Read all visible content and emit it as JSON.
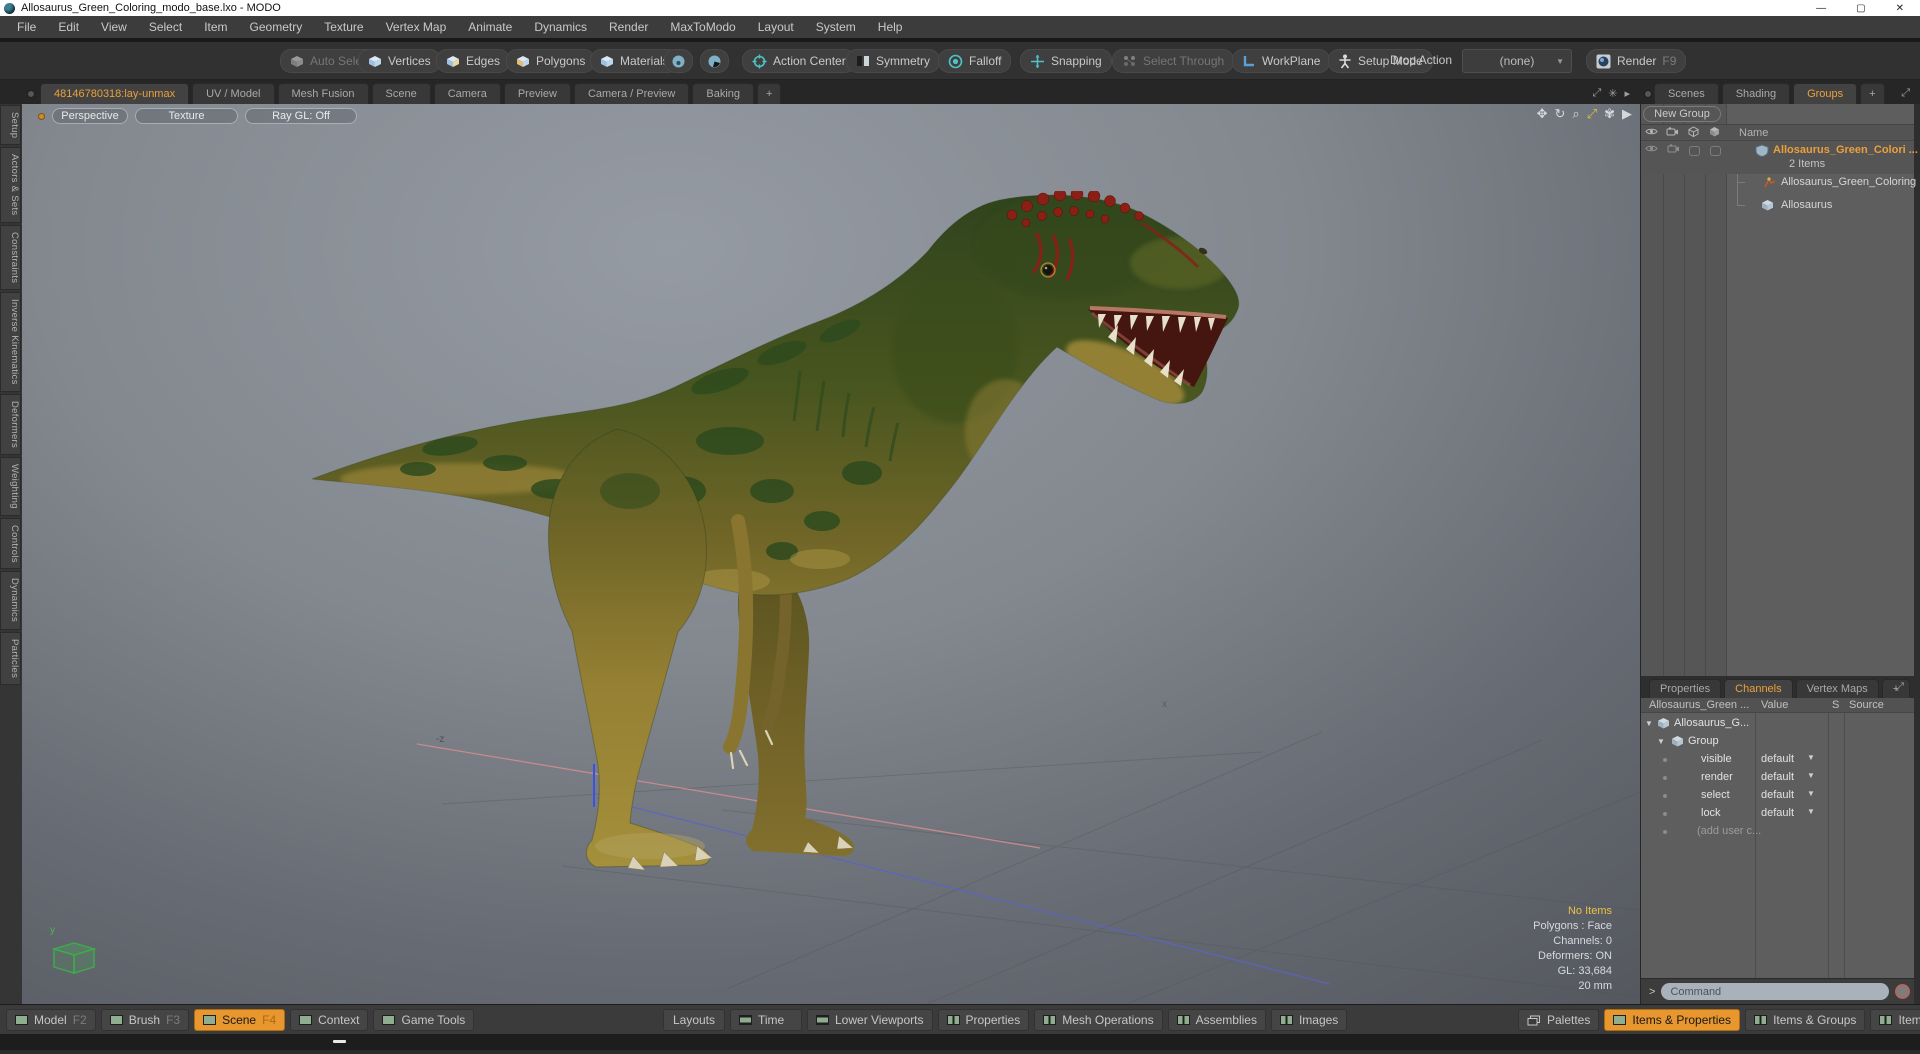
{
  "window": {
    "title": "Allosaurus_Green_Coloring_modo_base.lxo - MODO",
    "minimize": "—",
    "maximize": "▢",
    "close": "✕"
  },
  "menu": {
    "items": [
      "File",
      "Edit",
      "View",
      "Select",
      "Item",
      "Geometry",
      "Texture",
      "Vertex Map",
      "Animate",
      "Dynamics",
      "Render",
      "MaxToModo",
      "Layout",
      "System",
      "Help"
    ]
  },
  "toolbar": {
    "auto_select": "Auto Select",
    "vertices": "Vertices",
    "edges": "Edges",
    "polygons": "Polygons",
    "materials": "Materials",
    "action_center": "Action Center",
    "symmetry": "Symmetry",
    "falloff": "Falloff",
    "snapping": "Snapping",
    "select_through": "Select Through",
    "workplane": "WorkPlane",
    "setup_mode": "Setup Mode",
    "drop_action": "Drop Action",
    "drop_action_value": "(none)",
    "render": "Render",
    "render_shortcut": "F9"
  },
  "layout_tabs": {
    "active": "48146780318:lay-unmax",
    "items": [
      "UV / Model",
      "Mesh Fusion",
      "Scene",
      "Camera",
      "Preview",
      "Camera / Preview",
      "Baking"
    ],
    "add": "+"
  },
  "rail": {
    "items": [
      "Setup",
      "Actors & Sets",
      "Constraints",
      "Inverse Kinematics",
      "Deformers",
      "Weighting",
      "Controls",
      "Dynamics",
      "Particles"
    ]
  },
  "viewport": {
    "mode": "Perspective",
    "shading": "Texture",
    "raygl": "Ray GL: Off",
    "axis_z": "-z",
    "axis_x": "x",
    "gizmo_y": "y",
    "info": {
      "selection": "No Items",
      "lines": [
        "Polygons : Face",
        "Channels: 0",
        "Deformers: ON",
        "GL: 33,684",
        "20 mm"
      ]
    }
  },
  "groups_panel": {
    "tabs": [
      "Scenes",
      "Shading",
      "Groups"
    ],
    "add_tab": "+",
    "new_group": "New Group",
    "name_header": "Name",
    "group_row": {
      "label": "Allosaurus_Green_Colori ...",
      "count": "2 Items"
    },
    "children": [
      {
        "label": "Allosaurus_Green_Coloring"
      },
      {
        "label": "Allosaurus"
      }
    ]
  },
  "channels_panel": {
    "tabs": [
      "Properties",
      "Channels",
      "Vertex Maps"
    ],
    "add_tab": "+",
    "columns": [
      "Allosaurus_Green ...",
      "Value",
      "S",
      "Source"
    ],
    "tree": [
      {
        "label": "Allosaurus_G..."
      },
      {
        "label": "Group"
      }
    ],
    "channels": [
      {
        "label": "visible",
        "value": "default"
      },
      {
        "label": "render",
        "value": "default"
      },
      {
        "label": "select",
        "value": "default"
      },
      {
        "label": "lock",
        "value": "default"
      }
    ],
    "add_row": "(add user c..."
  },
  "command_bar": {
    "prompt": ">",
    "placeholder": "Command"
  },
  "bottom_bar": {
    "modes": [
      {
        "label": "Model",
        "key": "F2"
      },
      {
        "label": "Brush",
        "key": "F3"
      },
      {
        "label": "Scene",
        "key": "F4"
      },
      {
        "label": "Context",
        "key": ""
      },
      {
        "label": "Game Tools",
        "key": ""
      }
    ],
    "panels": [
      "Layouts",
      "Time",
      "Lower Viewports",
      "Properties",
      "Mesh Operations",
      "Assemblies",
      "Images"
    ],
    "right": [
      "Palettes",
      "Items & Properties",
      "Items & Groups",
      "Items & Shadin"
    ]
  },
  "colors": {
    "accent": "#eba03c",
    "active_button": "#e8962e",
    "highlight": "#e8c146"
  }
}
